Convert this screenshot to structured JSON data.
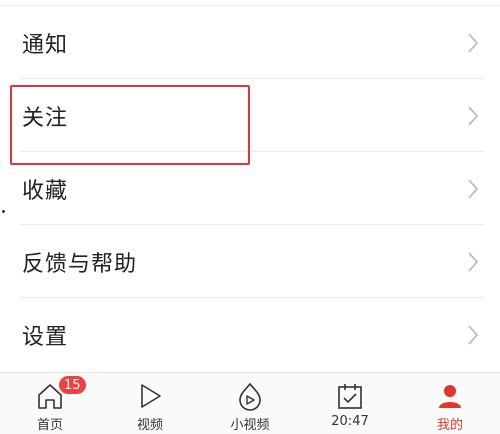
{
  "menu": {
    "items": [
      {
        "label": "通知"
      },
      {
        "label": "关注"
      },
      {
        "label": "收藏"
      },
      {
        "label": "反馈与帮助"
      },
      {
        "label": "设置"
      }
    ]
  },
  "tabbar": {
    "tabs": [
      {
        "label": "首页",
        "icon": "home-icon",
        "badge": "15"
      },
      {
        "label": "视频",
        "icon": "play-icon"
      },
      {
        "label": "小视频",
        "icon": "short-video-icon"
      },
      {
        "label": "20:47",
        "icon": "calendar-check-icon"
      },
      {
        "label": "我的",
        "icon": "user-icon",
        "active": true
      }
    ]
  },
  "colors": {
    "accent": "#e0362c",
    "badge": "#f04141",
    "highlight_border": "#d9363e"
  }
}
